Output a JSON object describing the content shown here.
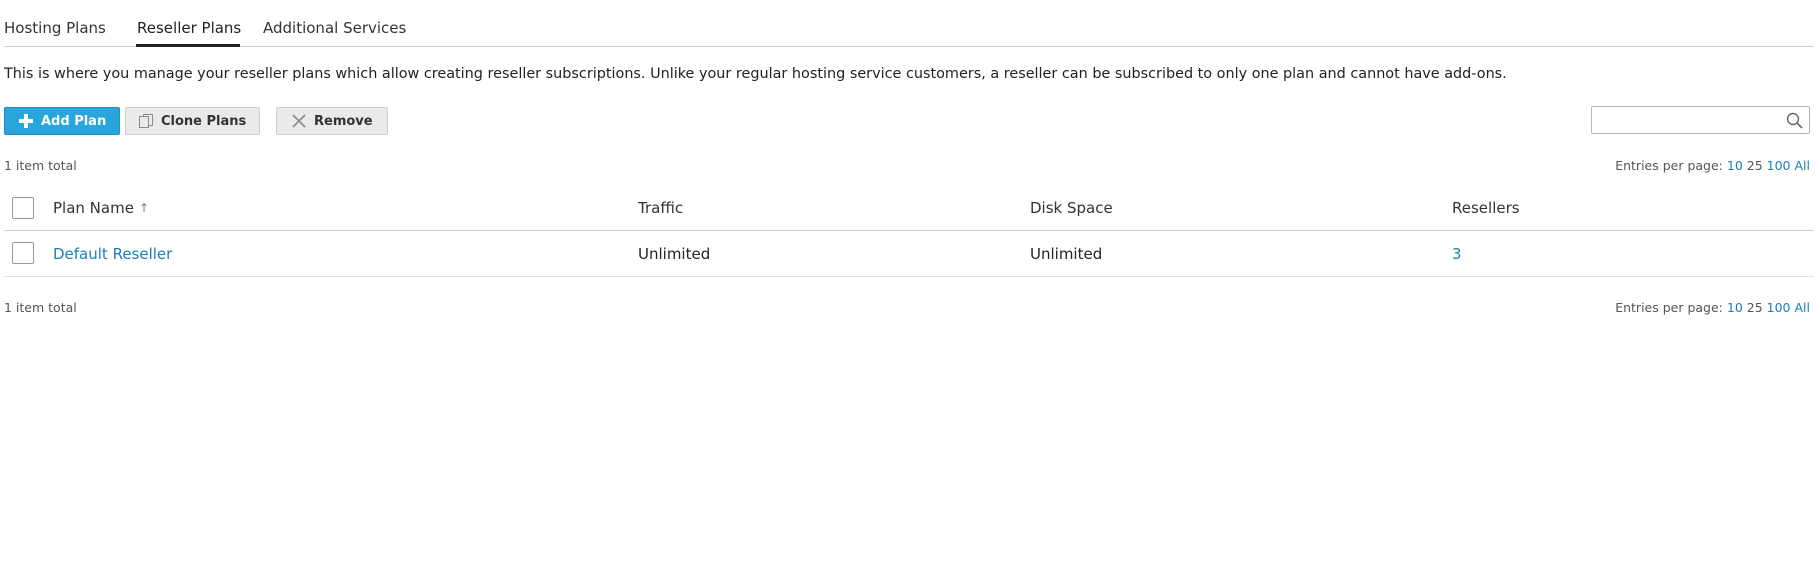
{
  "tabs": [
    {
      "label": "Hosting Plans",
      "active": false
    },
    {
      "label": "Reseller Plans",
      "active": true
    },
    {
      "label": "Additional Services",
      "active": false
    }
  ],
  "description": "This is where you manage your reseller plans which allow creating reseller subscriptions. Unlike your regular hosting service customers, a reseller can be subscribed to only one plan and cannot have add-ons.",
  "toolbar": {
    "add_label": "Add Plan",
    "clone_label": "Clone Plans",
    "remove_label": "Remove",
    "add_icon": "plus-icon",
    "clone_icon": "copy-icon",
    "remove_icon": "x-icon"
  },
  "search": {
    "placeholder": "",
    "value": "",
    "icon": "search-icon"
  },
  "summary": {
    "total_top": "1 item total",
    "total_bottom": "1 item total",
    "entries_label": "Entries per page:",
    "entries_options": [
      "10",
      "25",
      "100",
      "All"
    ],
    "entries_current": "25"
  },
  "table": {
    "columns": {
      "plan_name": "Plan Name",
      "sort_indicator": "↑",
      "traffic": "Traffic",
      "disk_space": "Disk Space",
      "resellers": "Resellers"
    },
    "rows": [
      {
        "plan_name": "Default Reseller",
        "traffic": "Unlimited",
        "disk_space": "Unlimited",
        "resellers": "3"
      }
    ]
  },
  "colors": {
    "primary_button": "#28a5dc",
    "link": "#1a7fb5",
    "active_tab_underline": "#222222"
  }
}
